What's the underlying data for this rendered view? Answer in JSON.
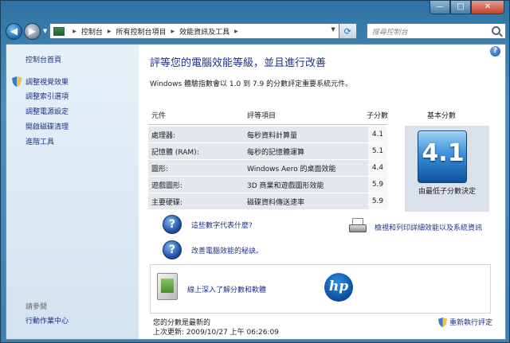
{
  "window": {
    "minimize_glyph": "—",
    "maximize_glyph": "□",
    "close_glyph": "✕"
  },
  "navbar": {
    "breadcrumbs": [
      "控制台",
      "所有控制台項目",
      "效能資訊及工具"
    ],
    "search_placeholder": "搜尋控制台"
  },
  "sidebar": {
    "home_label": "控制台首頁",
    "links": [
      "調整視覺效果",
      "調整索引選項",
      "調整電源設定",
      "開啟磁碟清理",
      "進階工具"
    ],
    "see_also_label": "請參閱",
    "see_also_links": [
      "行動作業中心"
    ]
  },
  "main": {
    "help": "?",
    "title": "評等您的電腦效能等級，並且進行改善",
    "description": "Windows 體驗指數會以 1.0 到 7.9 的分數評定重要系統元件。",
    "table": {
      "headers": {
        "component": "元件",
        "rating": "評等項目",
        "subscore": "子分數",
        "basescore": "基本分數"
      },
      "rows": [
        {
          "component": "處理器:",
          "rating": "每秒資料計算量",
          "subscore": "4.1"
        },
        {
          "component": "記憶體 (RAM):",
          "rating": "每秒的記憶體運算",
          "subscore": "5.1"
        },
        {
          "component": "圖形:",
          "rating": "Windows Aero 的桌面效能",
          "subscore": "4.4"
        },
        {
          "component": "遊戲圖形:",
          "rating": "3D 商業和遊戲圖形效能",
          "subscore": "5.9"
        },
        {
          "component": "主要硬碟:",
          "rating": "磁碟資料傳送速率",
          "subscore": "5.9"
        }
      ],
      "base_score": "4.1",
      "base_caption": "由最低子分數決定"
    },
    "links": {
      "what_mean": "這些數字代表什麼?",
      "improve": "改善電腦效能的秘訣。",
      "print_details": "檢視和列印詳細效能以及系統資訊"
    },
    "promo": {
      "link": "線上深入了解分數和軟體",
      "brand": "hp"
    },
    "status": {
      "up_to_date": "您的分數是最新的",
      "last_update": "上次更新: 2009/10/27 上午 06:26:09",
      "rerun": "重新執行評定"
    }
  }
}
